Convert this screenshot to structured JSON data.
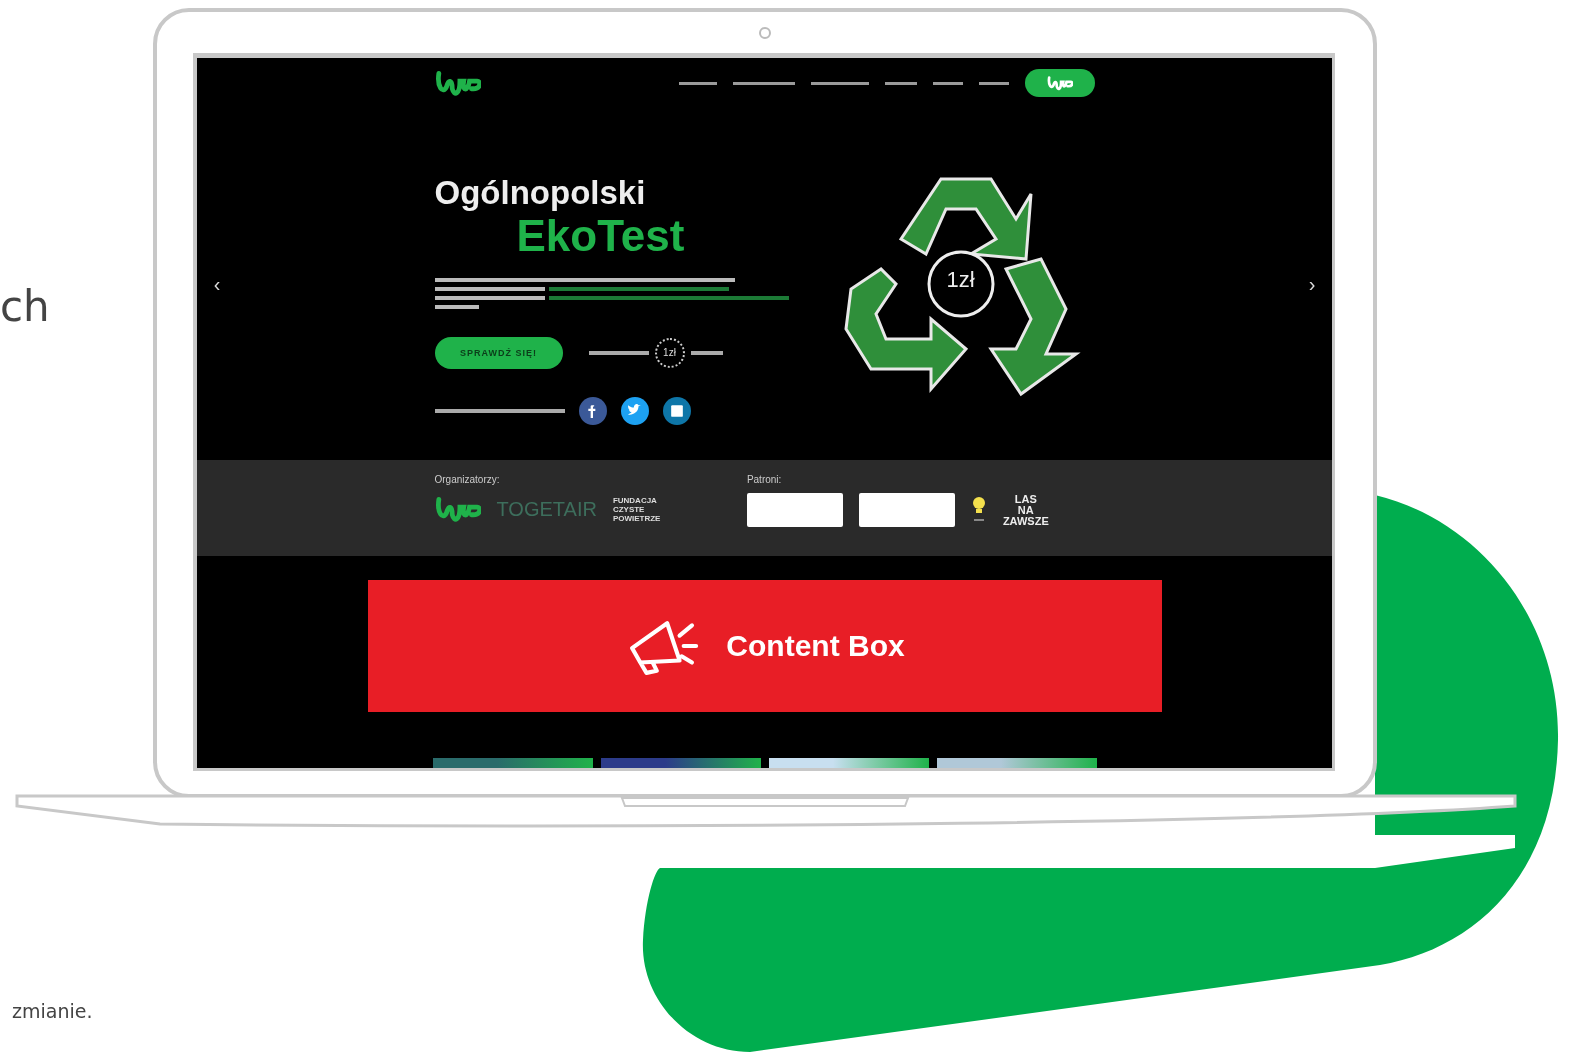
{
  "side_texts": [
    {
      "kind": "heading",
      "text": "ch"
    },
    {
      "kind": "note",
      "text": "zmianie."
    }
  ],
  "carousel": {
    "prev": "‹",
    "next": "›"
  },
  "hero": {
    "title": "Ogólnopolski",
    "highlight": "EkoTest",
    "cta": "SPRAWDŹ SIĘ!",
    "badge": "1zł",
    "graphic_badge": "1zł"
  },
  "partners": {
    "organizers_label": "Organizatorzy:",
    "organizers": [
      "TOGETAIR",
      "FUNDACJA CZYSTE POWIETRZE"
    ],
    "patrons_label": "Patroni:",
    "patron_wordmark": [
      "LAS",
      "NA",
      "ZAWSZE"
    ]
  },
  "content_box": {
    "label": "Content Box"
  }
}
